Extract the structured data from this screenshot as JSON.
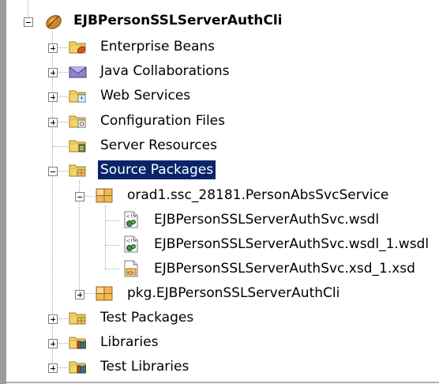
{
  "project": {
    "name": "EJBPersonSSLServerAuthCli",
    "expanded": true,
    "icon": "project-beans-icon"
  },
  "nodes": {
    "enterprise_beans": {
      "label": "Enterprise Beans",
      "icon": "folder-beans-icon",
      "expanded": false
    },
    "java_collaborations": {
      "label": "Java Collaborations",
      "icon": "collaboration-envelope-icon",
      "expanded": false
    },
    "web_services": {
      "label": "Web Services",
      "icon": "folder-web-services-icon",
      "expanded": false
    },
    "configuration_files": {
      "label": "Configuration Files",
      "icon": "folder-config-icon",
      "expanded": false
    },
    "server_resources": {
      "label": "Server Resources",
      "icon": "folder-server-resources-icon",
      "expanded": false
    },
    "source_packages": {
      "label": "Source Packages",
      "icon": "folder-source-icon",
      "expanded": true,
      "selected": true
    },
    "test_packages": {
      "label": "Test Packages",
      "icon": "folder-test-icon",
      "expanded": false
    },
    "libraries": {
      "label": "Libraries",
      "icon": "folder-libraries-icon",
      "expanded": false
    },
    "test_libraries": {
      "label": "Test Libraries",
      "icon": "folder-libraries-icon",
      "expanded": false
    }
  },
  "packages": [
    {
      "label": "orad1.ssc_28181.PersonAbsSvcService",
      "icon": "package-icon",
      "expanded": true,
      "files": [
        {
          "label": "EJBPersonSSLServerAuthSvc.wsdl",
          "icon": "wsdl-file-icon"
        },
        {
          "label": "EJBPersonSSLServerAuthSvc.wsdl_1.wsdl",
          "icon": "wsdl-file-icon"
        },
        {
          "label": "EJBPersonSSLServerAuthSvc.xsd_1.xsd",
          "icon": "xsd-file-icon"
        }
      ]
    },
    {
      "label": "pkg.EJBPersonSSLServerAuthCli",
      "icon": "package-icon",
      "expanded": false,
      "files": []
    }
  ],
  "colors": {
    "selection_background": "#0a246a",
    "selection_text": "#ffffff",
    "tree_lines": "#a8a8a8",
    "folder_yellow": "#f2d66b",
    "package_orange": "#e9a94a"
  }
}
